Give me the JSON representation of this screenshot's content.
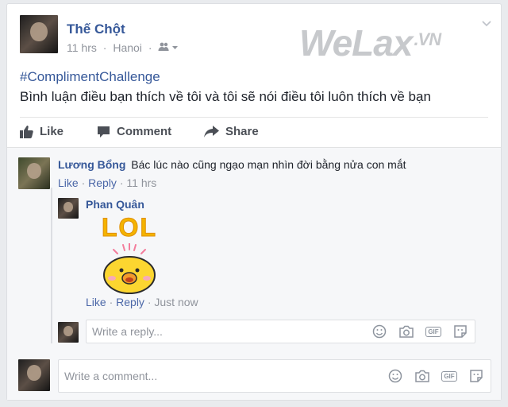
{
  "post": {
    "author": "Thế Chột",
    "time": "11 hrs",
    "location": "Hanoi",
    "hashtag": "#ComplimentChallenge",
    "text": "Bình luận điều bạn thích về tôi và tôi sẽ nói điều tôi luôn thích về bạn"
  },
  "watermark": {
    "brand": "WeLax",
    "suffix": ".VN"
  },
  "actions": {
    "like": "Like",
    "comment": "Comment",
    "share": "Share"
  },
  "comment": {
    "author": "Lương Bổng",
    "text": "Bác lúc nào cũng ngạo mạn nhìn đời bằng nửa con mắt",
    "like": "Like",
    "reply": "Reply",
    "time": "11 hrs"
  },
  "reply": {
    "author": "Phan Quân",
    "sticker_text": "LOL",
    "like": "Like",
    "reply": "Reply",
    "time": "Just now"
  },
  "reply_input": {
    "placeholder": "Write a reply..."
  },
  "comment_input": {
    "placeholder": "Write a comment..."
  },
  "separator": "·"
}
